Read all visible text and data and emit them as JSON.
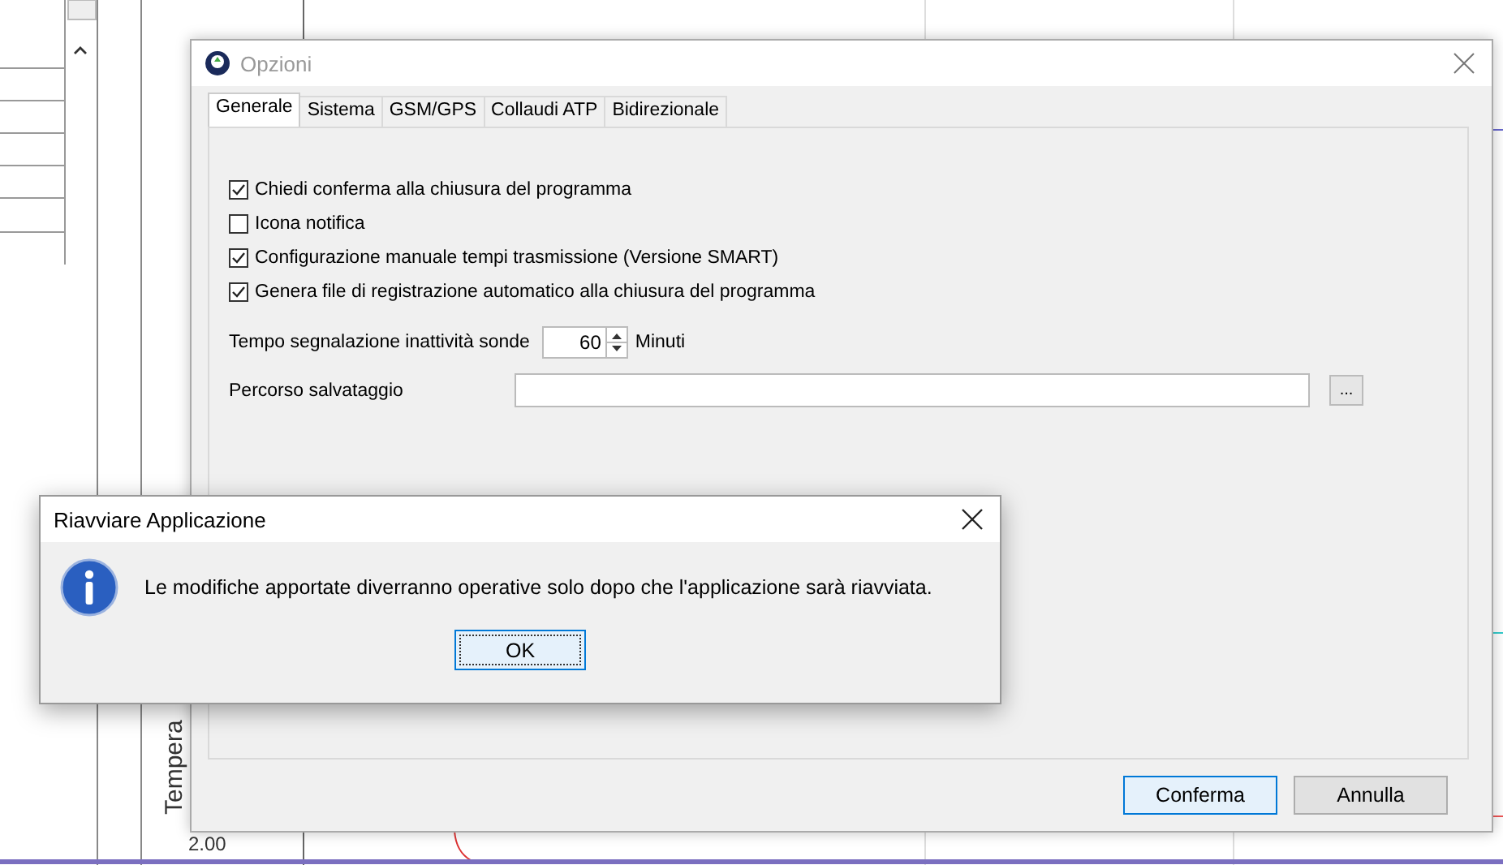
{
  "background": {
    "y_tick": "2.00",
    "y_axis_label": "Tempera"
  },
  "options_dialog": {
    "title": "Opzioni",
    "tabs": [
      {
        "label": "Generale",
        "selected": true
      },
      {
        "label": "Sistema",
        "selected": false
      },
      {
        "label": "GSM/GPS",
        "selected": false
      },
      {
        "label": "Collaudi ATP",
        "selected": false
      },
      {
        "label": "Bidirezionale",
        "selected": false
      }
    ],
    "checkboxes": [
      {
        "label": "Chiedi conferma alla chiusura del programma",
        "checked": true
      },
      {
        "label": "Icona notifica",
        "checked": false
      },
      {
        "label": "Configurazione manuale tempi trasmissione (Versione SMART)",
        "checked": true
      },
      {
        "label": "Genera file di registrazione automatico alla chiusura del programma",
        "checked": true
      }
    ],
    "probe_timeout": {
      "label": "Tempo segnalazione inattività sonde",
      "value": "60",
      "unit": "Minuti"
    },
    "save_path": {
      "label": "Percorso salvataggio",
      "browse_button": "..."
    },
    "buttons": [
      {
        "label": "Conferma",
        "default": true
      },
      {
        "label": "Annulla",
        "default": false
      }
    ]
  },
  "message_box": {
    "title": "Riavviare Applicazione",
    "message": "Le modifiche apportate diverranno operative solo dopo che l'applicazione sarà riavviata.",
    "button": "OK"
  }
}
